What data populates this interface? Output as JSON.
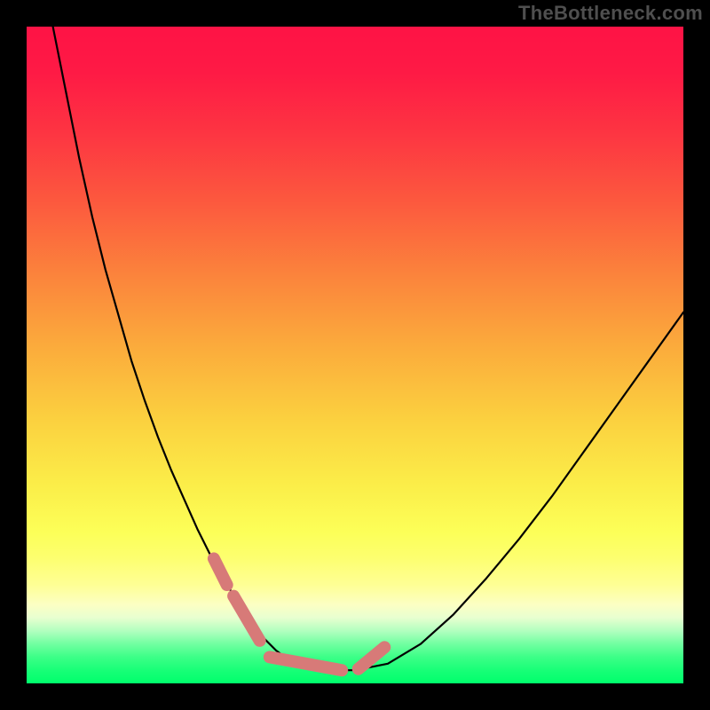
{
  "watermark": "TheBottleneck.com",
  "chart_data": {
    "type": "line",
    "title": "",
    "xlabel": "",
    "ylabel": "",
    "xlim": [
      0,
      100
    ],
    "ylim": [
      0,
      100
    ],
    "grid": false,
    "legend": false,
    "series": [
      {
        "name": "bottleneck-curve",
        "x": [
          4,
          6,
          8,
          10,
          12,
          14,
          16,
          18,
          20,
          22,
          24,
          26,
          28,
          30,
          32,
          34,
          36,
          38,
          40,
          45,
          50,
          55,
          60,
          65,
          70,
          75,
          80,
          85,
          90,
          95,
          100
        ],
        "values": [
          100,
          90,
          80,
          71,
          63,
          56,
          49,
          43,
          37.5,
          32.5,
          28,
          23.5,
          19.5,
          16,
          12.5,
          9.5,
          7,
          5,
          3.5,
          2,
          2,
          3,
          6,
          10.5,
          16,
          22,
          28.5,
          35.5,
          42.5,
          49.5,
          56.5
        ]
      }
    ],
    "marker_segments": [
      {
        "name": "left-upper",
        "x": [
          28.5,
          30.5
        ],
        "values": [
          19,
          15
        ]
      },
      {
        "name": "left-lower",
        "x": [
          31.5,
          35.5
        ],
        "values": [
          13.3,
          6.5
        ]
      },
      {
        "name": "valley",
        "x": [
          37,
          48
        ],
        "values": [
          4,
          2
        ]
      },
      {
        "name": "right",
        "x": [
          50.5,
          54.5
        ],
        "values": [
          2.2,
          5.5
        ]
      }
    ],
    "gradient_stops": [
      {
        "pos": 0,
        "color": "#fe1345"
      },
      {
        "pos": 50,
        "color": "#fbac3c"
      },
      {
        "pos": 77,
        "color": "#fcff58"
      },
      {
        "pos": 100,
        "color": "#00ff6c"
      }
    ]
  }
}
